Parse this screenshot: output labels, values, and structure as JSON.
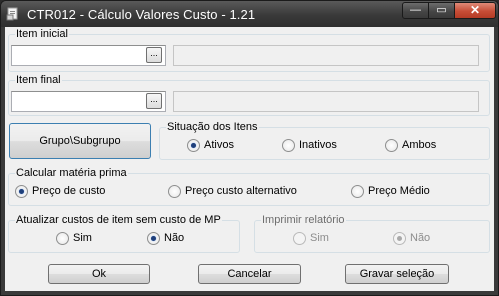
{
  "window": {
    "title": "CTR012 - Cálculo Valores Custo - 1.21",
    "minimize": "—",
    "maximize": "▭",
    "close": "✕",
    "icon": "application-icon"
  },
  "item_inicial": {
    "label": "Item inicial",
    "value": "",
    "description": "",
    "browse": "..."
  },
  "item_final": {
    "label": "Item final",
    "value": "",
    "description": "",
    "browse": "..."
  },
  "grupo_button": "Grupo\\Subgrupo",
  "situacao": {
    "label": "Situação dos Itens",
    "options": [
      "Ativos",
      "Inativos",
      "Ambos"
    ],
    "selected": "Ativos"
  },
  "calcular": {
    "label": "Calcular matéria prima",
    "options": [
      "Preço de custo",
      "Preço custo alternativo",
      "Preço Médio"
    ],
    "selected": "Preço de custo"
  },
  "atualizar": {
    "label": "Atualizar custos de item sem custo de MP",
    "options": [
      "Sim",
      "Não"
    ],
    "selected": "Não"
  },
  "imprimir": {
    "label": "Imprimir relatório",
    "options": [
      "Sim",
      "Não"
    ],
    "selected": "Não",
    "enabled": false
  },
  "buttons": {
    "ok": "Ok",
    "cancel": "Cancelar",
    "save": "Gravar seleção"
  }
}
